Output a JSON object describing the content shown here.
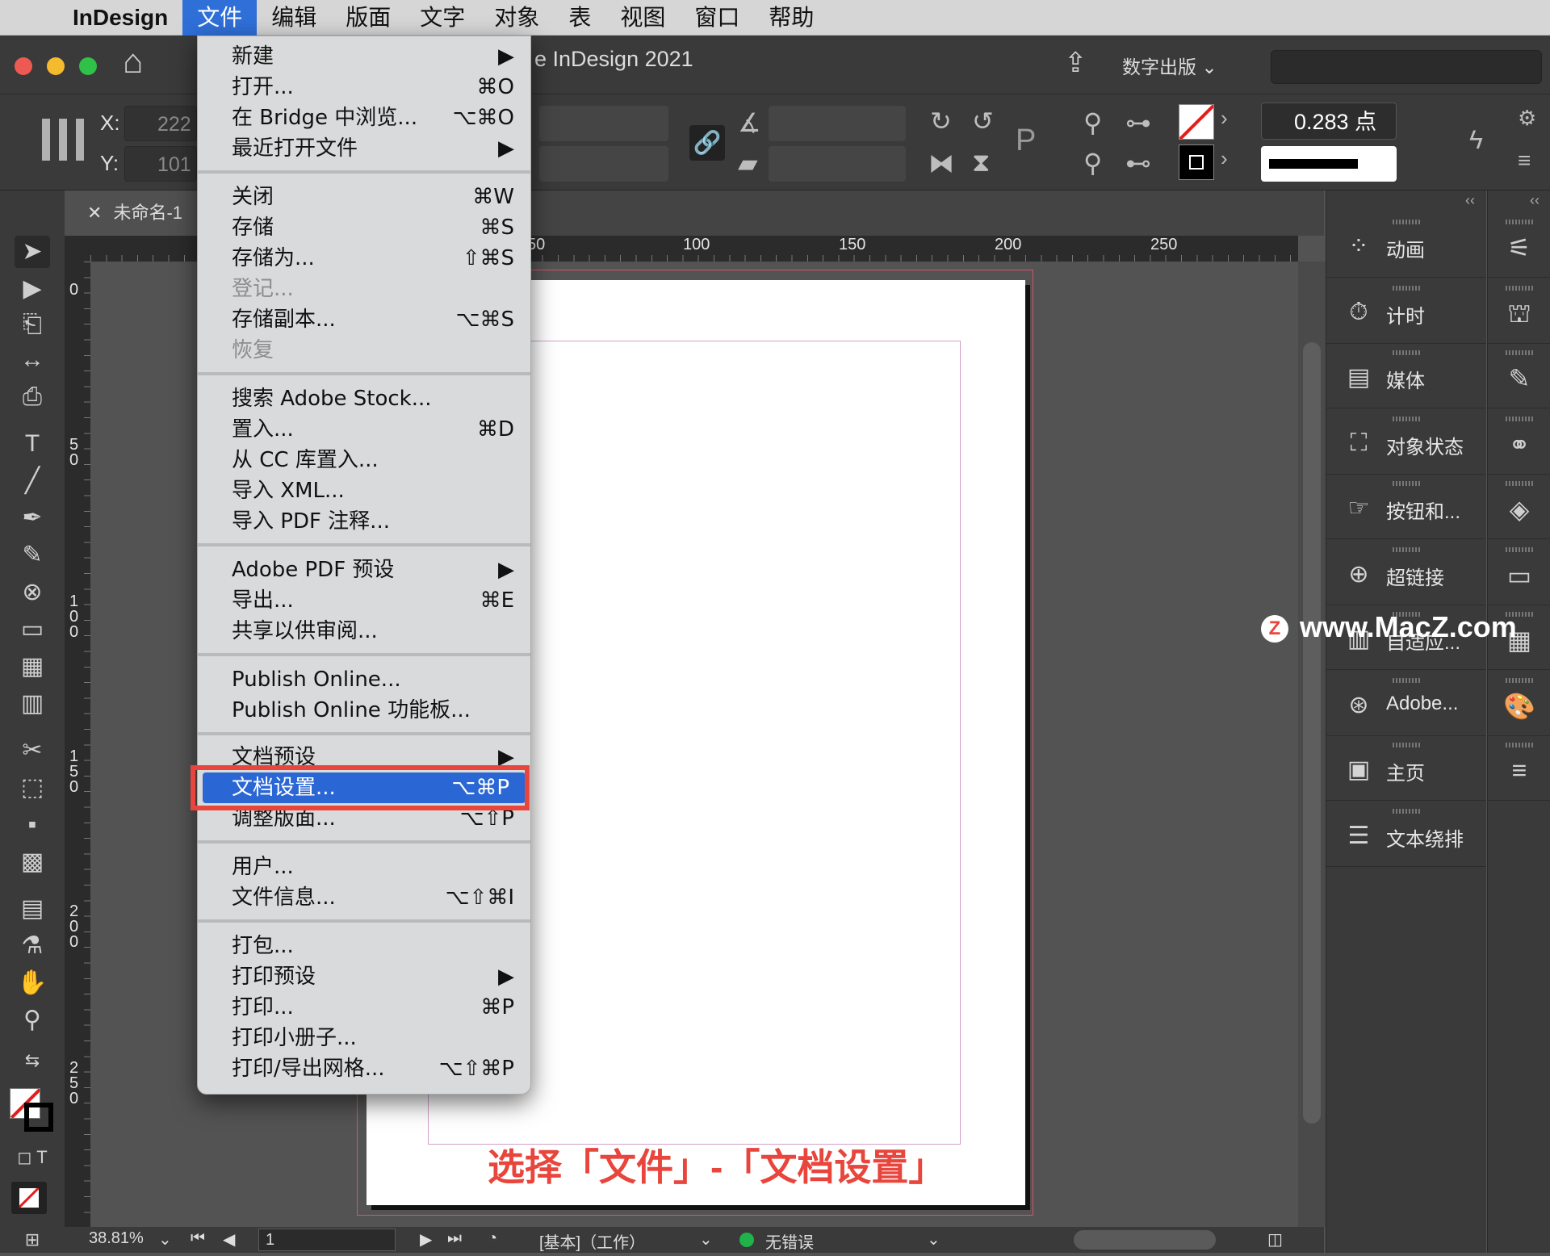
{
  "menubar": {
    "app_name": "InDesign",
    "items": [
      "文件",
      "编辑",
      "版面",
      "文字",
      "对象",
      "表",
      "视图",
      "窗口",
      "帮助"
    ]
  },
  "titlebar": {
    "title": "e InDesign 2021",
    "workspace": "数字出版"
  },
  "control_panel": {
    "x_label": "X:",
    "y_label": "Y:",
    "x_value": "222",
    "y_value": "101",
    "stroke_weight": "0.283 点"
  },
  "document": {
    "tab_title": "未命名-1 @",
    "ruler_top": [
      "50",
      "100",
      "150",
      "200",
      "250"
    ],
    "ruler_left": [
      "0",
      "50",
      "100",
      "150",
      "200",
      "250"
    ]
  },
  "file_menu": {
    "items": [
      {
        "label": "新建",
        "shortcut": "▶"
      },
      {
        "label": "打开...",
        "shortcut": "⌘O"
      },
      {
        "label": "在 Bridge 中浏览...",
        "shortcut": "⌥⌘O"
      },
      {
        "label": "最近打开文件",
        "shortcut": "▶"
      },
      {
        "label": "关闭",
        "shortcut": "⌘W"
      },
      {
        "label": "存储",
        "shortcut": "⌘S"
      },
      {
        "label": "存储为...",
        "shortcut": "⇧⌘S"
      },
      {
        "label": "登记...",
        "shortcut": ""
      },
      {
        "label": "存储副本...",
        "shortcut": "⌥⌘S"
      },
      {
        "label": "恢复",
        "shortcut": ""
      },
      {
        "label": "搜索 Adobe Stock...",
        "shortcut": ""
      },
      {
        "label": "置入...",
        "shortcut": "⌘D"
      },
      {
        "label": "从 CC 库置入...",
        "shortcut": ""
      },
      {
        "label": "导入 XML...",
        "shortcut": ""
      },
      {
        "label": "导入 PDF 注释...",
        "shortcut": ""
      },
      {
        "label": "Adobe PDF 预设",
        "shortcut": "▶"
      },
      {
        "label": "导出...",
        "shortcut": "⌘E"
      },
      {
        "label": "共享以供审阅...",
        "shortcut": ""
      },
      {
        "label": "Publish Online...",
        "shortcut": ""
      },
      {
        "label": "Publish Online 功能板...",
        "shortcut": ""
      },
      {
        "label": "文档预设",
        "shortcut": "▶"
      },
      {
        "label": "文档设置...",
        "shortcut": "⌥⌘P"
      },
      {
        "label": "调整版面...",
        "shortcut": "⌥⇧P"
      },
      {
        "label": "用户...",
        "shortcut": ""
      },
      {
        "label": "文件信息...",
        "shortcut": "⌥⇧⌘I"
      },
      {
        "label": "打包...",
        "shortcut": ""
      },
      {
        "label": "打印预设",
        "shortcut": "▶"
      },
      {
        "label": "打印...",
        "shortcut": "⌘P"
      },
      {
        "label": "打印小册子...",
        "shortcut": ""
      },
      {
        "label": "打印/导出网格...",
        "shortcut": "⌥⇧⌘P"
      }
    ]
  },
  "panels": {
    "items": [
      "动画",
      "计时",
      "媒体",
      "对象状态",
      "按钮和...",
      "超链接",
      "自适应...",
      "Adobe...",
      "主页",
      "文本绕排"
    ]
  },
  "statusbar": {
    "zoom": "38.81%",
    "page": "1",
    "style": "[基本]（工作）",
    "preflight": "无错误"
  },
  "caption": "选择「文件」-「文档设置」",
  "watermark": "www.MacZ.com"
}
